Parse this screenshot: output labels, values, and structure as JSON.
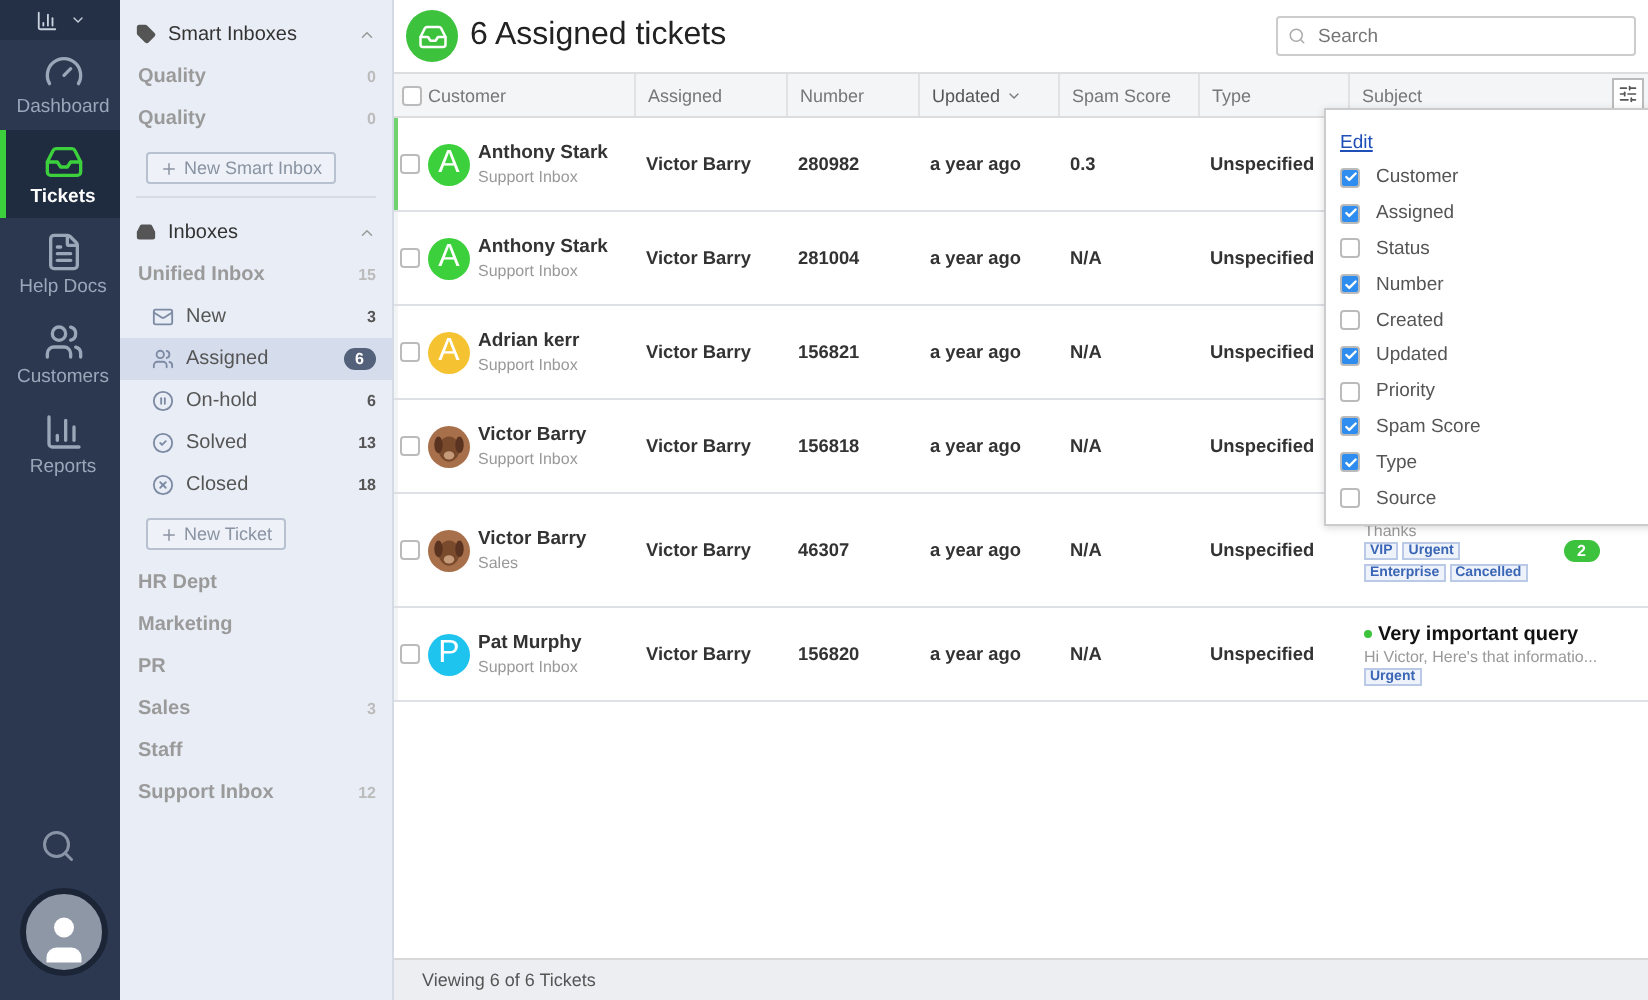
{
  "nav": {
    "items": [
      {
        "label": "Dashboard",
        "selected": false
      },
      {
        "label": "Tickets",
        "selected": true
      },
      {
        "label": "Help Docs",
        "selected": false
      },
      {
        "label": "Customers",
        "selected": false
      },
      {
        "label": "Reports",
        "selected": false
      }
    ]
  },
  "sidebar": {
    "sections": [
      {
        "title": "Smart Inboxes",
        "expanded": true,
        "items": [
          {
            "label": "Quality",
            "count": "0"
          },
          {
            "label": "Quality",
            "count": "0"
          }
        ],
        "button": "New Smart Inbox"
      },
      {
        "title": "Inboxes",
        "expanded": true,
        "items": [
          {
            "label": "Unified Inbox",
            "count": "15",
            "children": [
              {
                "label": "New",
                "count": "3",
                "selected": false
              },
              {
                "label": "Assigned",
                "count": "6",
                "selected": true
              },
              {
                "label": "On-hold",
                "count": "6",
                "selected": false
              },
              {
                "label": "Solved",
                "count": "13",
                "selected": false
              },
              {
                "label": "Closed",
                "count": "18",
                "selected": false
              }
            ]
          }
        ],
        "button": "New Ticket"
      }
    ],
    "inboxes": [
      {
        "label": "HR Dept"
      },
      {
        "label": "Marketing"
      },
      {
        "label": "PR"
      },
      {
        "label": "Sales",
        "count": "3"
      },
      {
        "label": "Staff"
      },
      {
        "label": "Support Inbox",
        "count": "12"
      }
    ]
  },
  "header": {
    "title": "6 Assigned tickets",
    "search": {
      "placeholder": "Search"
    }
  },
  "table": {
    "select_all": {
      "checked": false
    },
    "columns": [
      {
        "label": "Customer",
        "sorted": false
      },
      {
        "label": "Assigned",
        "sorted": false
      },
      {
        "label": "Number",
        "sorted": false
      },
      {
        "label": "Updated",
        "sorted": true
      },
      {
        "label": "Spam Score",
        "sorted": false
      },
      {
        "label": "Type",
        "sorted": false
      },
      {
        "label": "Subject",
        "sorted": false
      }
    ],
    "rows": [
      {
        "selected": true,
        "checked": false,
        "avatar": {
          "kind": "letter",
          "letter": "A",
          "color": "#3cd13c"
        },
        "customer": "Anthony Stark",
        "inbox": "Support Inbox",
        "assigned": "Victor Barry",
        "number": "280982",
        "updated": "a year ago",
        "spam_score": "0.3",
        "type": "Unspecified"
      },
      {
        "selected": false,
        "checked": false,
        "avatar": {
          "kind": "letter",
          "letter": "A",
          "color": "#3cd13c"
        },
        "customer": "Anthony Stark",
        "inbox": "Support Inbox",
        "assigned": "Victor Barry",
        "number": "281004",
        "updated": "a year ago",
        "spam_score": "N/A",
        "type": "Unspecified"
      },
      {
        "selected": false,
        "checked": false,
        "avatar": {
          "kind": "letter",
          "letter": "A",
          "color": "#f5c232"
        },
        "customer": "Adrian kerr",
        "inbox": "Support Inbox",
        "assigned": "Victor Barry",
        "number": "156821",
        "updated": "a year ago",
        "spam_score": "N/A",
        "type": "Unspecified"
      },
      {
        "selected": false,
        "checked": false,
        "customer": "Victor Barry",
        "inbox": "Support Inbox",
        "assigned": "Victor Barry",
        "number": "156818",
        "updated": "a year ago",
        "spam_score": "N/A",
        "type": "Unspecified"
      },
      {
        "selected": false,
        "checked": false,
        "customer": "Victor Barry",
        "inbox": "Sales",
        "assigned": "Victor Barry",
        "number": "46307",
        "updated": "a year ago",
        "spam_score": "N/A",
        "type": "Unspecified",
        "subject": {
          "preview": "Thanks",
          "tags": [
            "VIP",
            "Urgent",
            "Enterprise",
            "Cancelled"
          ],
          "count": "2"
        }
      },
      {
        "selected": false,
        "checked": false,
        "avatar": {
          "kind": "letter",
          "letter": "P",
          "color": "#1ec3ee"
        },
        "customer": "Pat Murphy",
        "inbox": "Support Inbox",
        "assigned": "Victor Barry",
        "number": "156820",
        "updated": "a year ago",
        "spam_score": "N/A",
        "type": "Unspecified",
        "subject": {
          "unread": true,
          "title": "Very important query",
          "preview": "Hi Victor, Here's that informatio...",
          "tags": [
            "Urgent"
          ]
        }
      }
    ]
  },
  "column_menu": {
    "edit": "Edit",
    "options": [
      {
        "label": "Customer",
        "checked": true
      },
      {
        "label": "Assigned",
        "checked": true
      },
      {
        "label": "Status",
        "checked": false
      },
      {
        "label": "Number",
        "checked": true
      },
      {
        "label": "Created",
        "checked": false
      },
      {
        "label": "Updated",
        "checked": true
      },
      {
        "label": "Priority",
        "checked": false
      },
      {
        "label": "Spam Score",
        "checked": true
      },
      {
        "label": "Type",
        "checked": true
      },
      {
        "label": "Source",
        "checked": false
      }
    ]
  },
  "status_bar": "Viewing 6 of 6 Tickets"
}
